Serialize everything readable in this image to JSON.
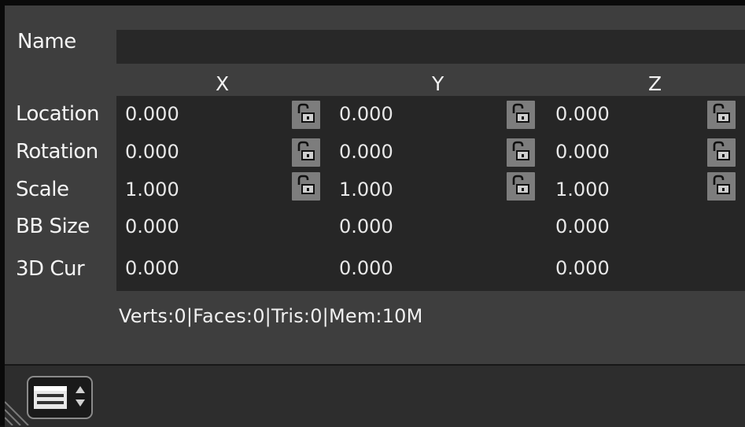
{
  "panel": {
    "name_label": "Name",
    "name_value": ""
  },
  "axes": [
    "X",
    "Y",
    "Z"
  ],
  "rows": [
    {
      "label": "Location",
      "values": [
        "0.000",
        "0.000",
        "0.000"
      ],
      "locks": true
    },
    {
      "label": "Rotation",
      "values": [
        "0.000",
        "0.000",
        "0.000"
      ],
      "locks": true
    },
    {
      "label": "Scale",
      "values": [
        "1.000",
        "1.000",
        "1.000"
      ],
      "locks": true
    },
    {
      "label": "BB Size",
      "values": [
        "0.000",
        "0.000",
        "0.000"
      ],
      "locks": false
    },
    {
      "label": "3D Cur",
      "values": [
        "0.000",
        "0.000",
        "0.000"
      ],
      "locks": false
    }
  ],
  "status": "Verts:0|Faces:0|Tris:0|Mem:10M",
  "icons": {
    "lock": "unlocked-padlock-icon",
    "menu": "panel-menu-icon",
    "resize": "resize-corner-icon"
  },
  "colors": {
    "panel_bg": "#3e3e3e",
    "field_bg": "#262626",
    "lock_bg": "#7d7d7d"
  }
}
